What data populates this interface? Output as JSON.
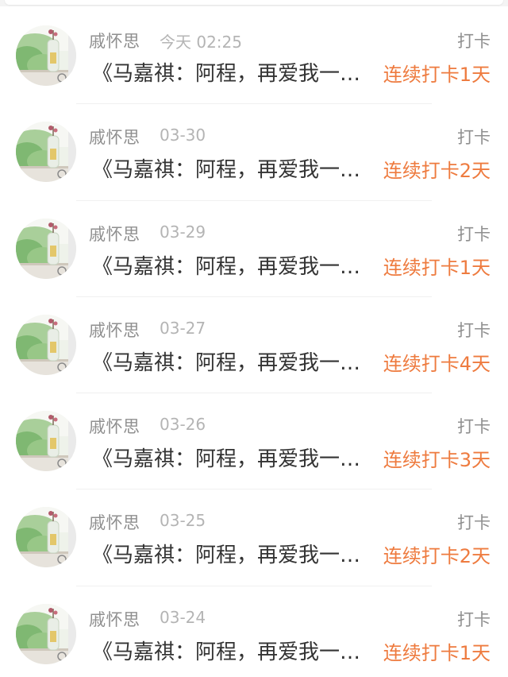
{
  "colors": {
    "accent": "#ee7b3f",
    "name_text": "#8f8f8f",
    "time_text": "#b4b4b4",
    "title_text": "#333333"
  },
  "items": [
    {
      "user": "戚怀思",
      "time": "今天 02:25",
      "tag": "打卡",
      "title": "《马嘉祺：阿程，再爱我一…",
      "streak": "连续打卡1天"
    },
    {
      "user": "戚怀思",
      "time": "03-30",
      "tag": "打卡",
      "title": "《马嘉祺：阿程，再爱我一…",
      "streak": "连续打卡2天"
    },
    {
      "user": "戚怀思",
      "time": "03-29",
      "tag": "打卡",
      "title": "《马嘉祺：阿程，再爱我一…",
      "streak": "连续打卡1天"
    },
    {
      "user": "戚怀思",
      "time": "03-27",
      "tag": "打卡",
      "title": "《马嘉祺：阿程，再爱我一…",
      "streak": "连续打卡4天"
    },
    {
      "user": "戚怀思",
      "time": "03-26",
      "tag": "打卡",
      "title": "《马嘉祺：阿程，再爱我一…",
      "streak": "连续打卡3天"
    },
    {
      "user": "戚怀思",
      "time": "03-25",
      "tag": "打卡",
      "title": "《马嘉祺：阿程，再爱我一…",
      "streak": "连续打卡2天"
    },
    {
      "user": "戚怀思",
      "time": "03-24",
      "tag": "打卡",
      "title": "《马嘉祺：阿程，再爱我一…",
      "streak": "连续打卡1天"
    }
  ]
}
